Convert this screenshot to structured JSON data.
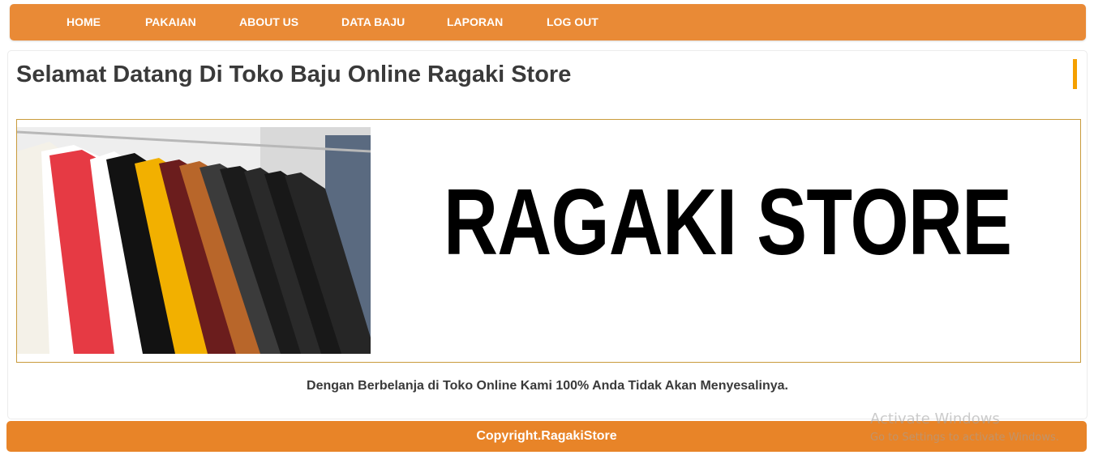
{
  "nav": {
    "items": [
      {
        "label": "HOME"
      },
      {
        "label": "PAKAIAN"
      },
      {
        "label": "ABOUT US"
      },
      {
        "label": "DATA BAJU"
      },
      {
        "label": "LAPORAN"
      },
      {
        "label": "LOG OUT"
      }
    ]
  },
  "main": {
    "title": "Selamat Datang Di Toko Baju Online Ragaki Store",
    "banner_brand": "RAGAKI STORE",
    "tagline": "Dengan Berbelanja di Toko Online Kami 100% Anda Tidak Akan Menyesalinya."
  },
  "footer": {
    "copyright": "Copyright.RagakiStore"
  },
  "os_watermark": {
    "title": "Activate Windows",
    "subtitle": "Go to Settings to activate Windows."
  },
  "colors": {
    "nav_bg": "#e98a36",
    "footer_bg": "#e88428",
    "accent": "#f5a000",
    "banner_border": "#c99b3c"
  }
}
